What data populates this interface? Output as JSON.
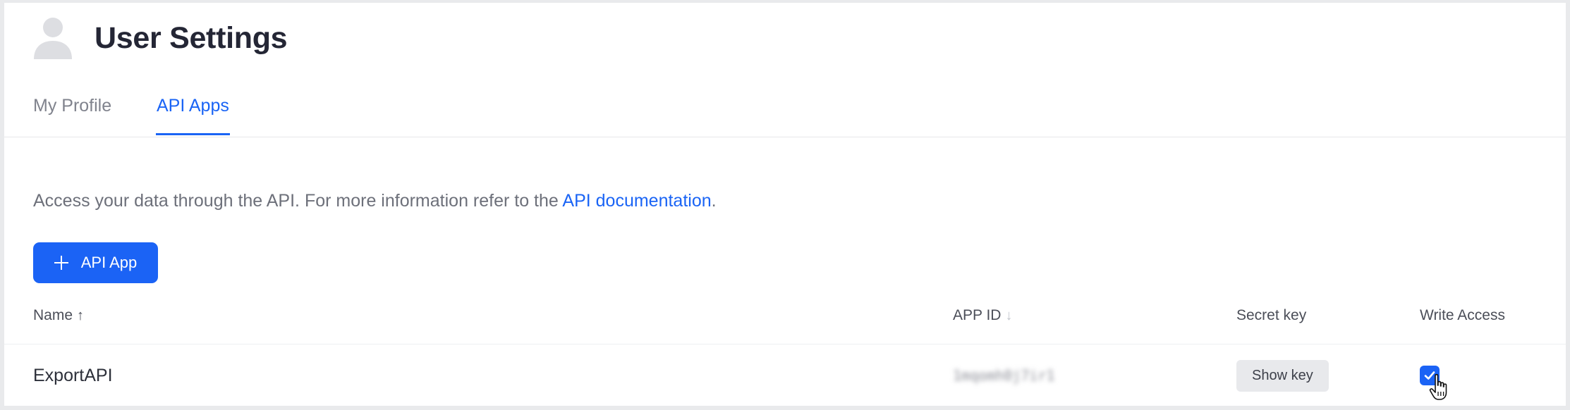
{
  "header": {
    "title": "User Settings",
    "avatar_icon": "user-avatar-icon"
  },
  "tabs": [
    {
      "label": "My Profile",
      "active": false
    },
    {
      "label": "API Apps",
      "active": true
    }
  ],
  "intro": {
    "text": "Access your data through the API. For more information refer to the ",
    "link_text": "API documentation",
    "suffix": "."
  },
  "add_button": {
    "label": "API App",
    "icon": "plus-icon"
  },
  "table": {
    "columns": [
      {
        "label": "Name",
        "sort": "↑"
      },
      {
        "label": "APP ID",
        "sort": "↓"
      },
      {
        "label": "Secret key"
      },
      {
        "label": "Write Access"
      }
    ],
    "rows": [
      {
        "name": "ExportAPI",
        "app_id": "1mqomh0j7ir1",
        "secret_key_button": "Show key",
        "write_access": true
      }
    ]
  },
  "colors": {
    "accent": "#1a64f5",
    "title": "#242635",
    "muted_text": "#6d707a"
  }
}
